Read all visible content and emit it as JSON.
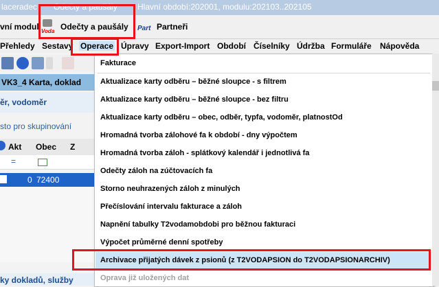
{
  "title_bar": {
    "left_fragment": "laceradec",
    "doc_title": "Odečty a paušály",
    "period_text": "Hlavní období:202001, modulu:202103..202105"
  },
  "modules": {
    "left_fragment": "vní modul",
    "readings_tab": {
      "label": "Odečty a paušály",
      "icon_text": "Voda"
    },
    "partners_tab": {
      "label": "Partneři",
      "icon_text": "Part"
    }
  },
  "menubar": {
    "items": [
      "Přehledy",
      "Sestavy",
      "Operace",
      "Úpravy",
      "Export-Import",
      "Období",
      "Číselníky",
      "Údržba",
      "Formuláře",
      "Nápověda"
    ]
  },
  "background": {
    "view_title": "VK3_4  Karta, doklad",
    "filter_text": "ěr, vodoměr",
    "group_hint": "sto pro skupinování",
    "col_akt": "Akt",
    "col_obec": "Obec",
    "col_z": "Z",
    "filter_eq": "=",
    "row_value": "0",
    "row_obec": "72400",
    "bottom_text": "ky dokladů, služby"
  },
  "dropdown": {
    "items": [
      "Fakturace",
      "Aktualizace karty odběru – běžné sloupce - s filtrem",
      "Aktualizace karty odběru – běžné sloupce - bez filtru",
      "Aktualizace karty odběru – obec, odběr, typfa, vodoměr, platnostOd",
      "Hromadná tvorba zálohové fa k období - dny výpočtem",
      "Hromadná tvorba záloh - splátkový kalendář i jednotlivá fa",
      "Odečty záloh na zúčtovacích fa",
      "Storno neuhrazených záloh z minulých",
      "Přečíslování intervalu fakturace a záloh",
      "Napnění tabulky T2vodamobdobi pro běžnou fakturaci",
      "Výpočet průměrné denní spotřeby",
      "Archivace přijatých dávek z psionů (z T2VODAPSION do  T2VODAPSIONARCHIV)",
      "Oprava již uložených dat"
    ]
  },
  "colors": {
    "highlight": "#cce4f7",
    "annotation_red": "#e3141c",
    "disabled_text": "#a0a0a0"
  }
}
